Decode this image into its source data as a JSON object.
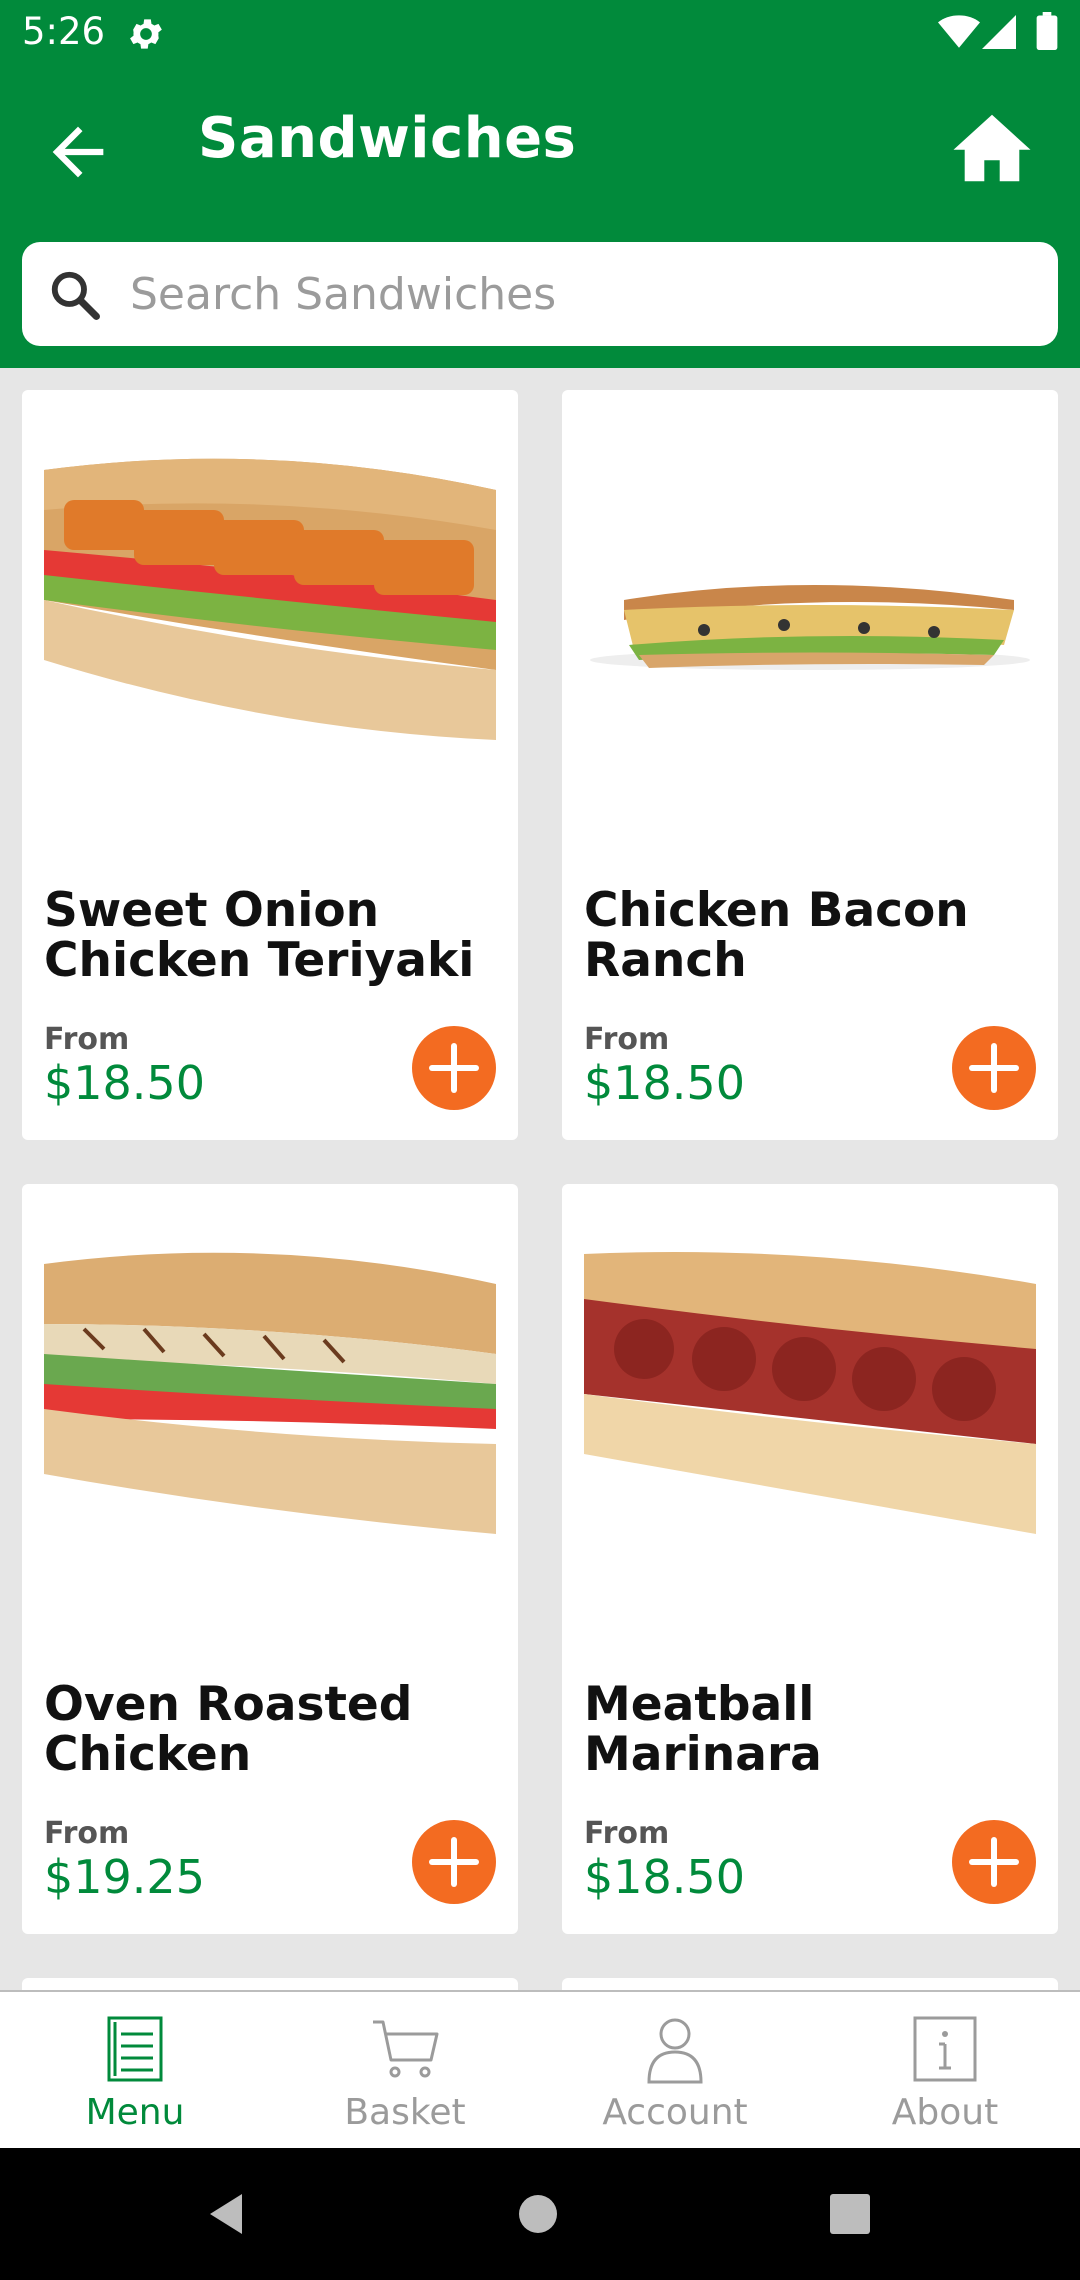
{
  "status_bar": {
    "time": "5:26"
  },
  "header": {
    "title": "Sandwiches"
  },
  "search": {
    "placeholder": "Search Sandwiches"
  },
  "products": [
    {
      "name": "Sweet Onion Chicken Teriyaki",
      "from_label": "From",
      "price": "$18.50"
    },
    {
      "name": "Chicken Bacon Ranch",
      "from_label": "From",
      "price": "$18.50"
    },
    {
      "name": "Oven Roasted Chicken",
      "from_label": "From",
      "price": "$19.25"
    },
    {
      "name": "Meatball Marinara",
      "from_label": "From",
      "price": "$18.50"
    }
  ],
  "bottom_nav": [
    {
      "label": "Menu",
      "icon": "menu-icon",
      "active": true
    },
    {
      "label": "Basket",
      "icon": "basket-icon",
      "active": false
    },
    {
      "label": "Account",
      "icon": "account-icon",
      "active": false
    },
    {
      "label": "About",
      "icon": "about-icon",
      "active": false
    }
  ],
  "colors": {
    "brand_green": "#018a3b",
    "accent_orange": "#f36b21",
    "price_green": "#018a3b",
    "background": "#e6e6e6"
  }
}
